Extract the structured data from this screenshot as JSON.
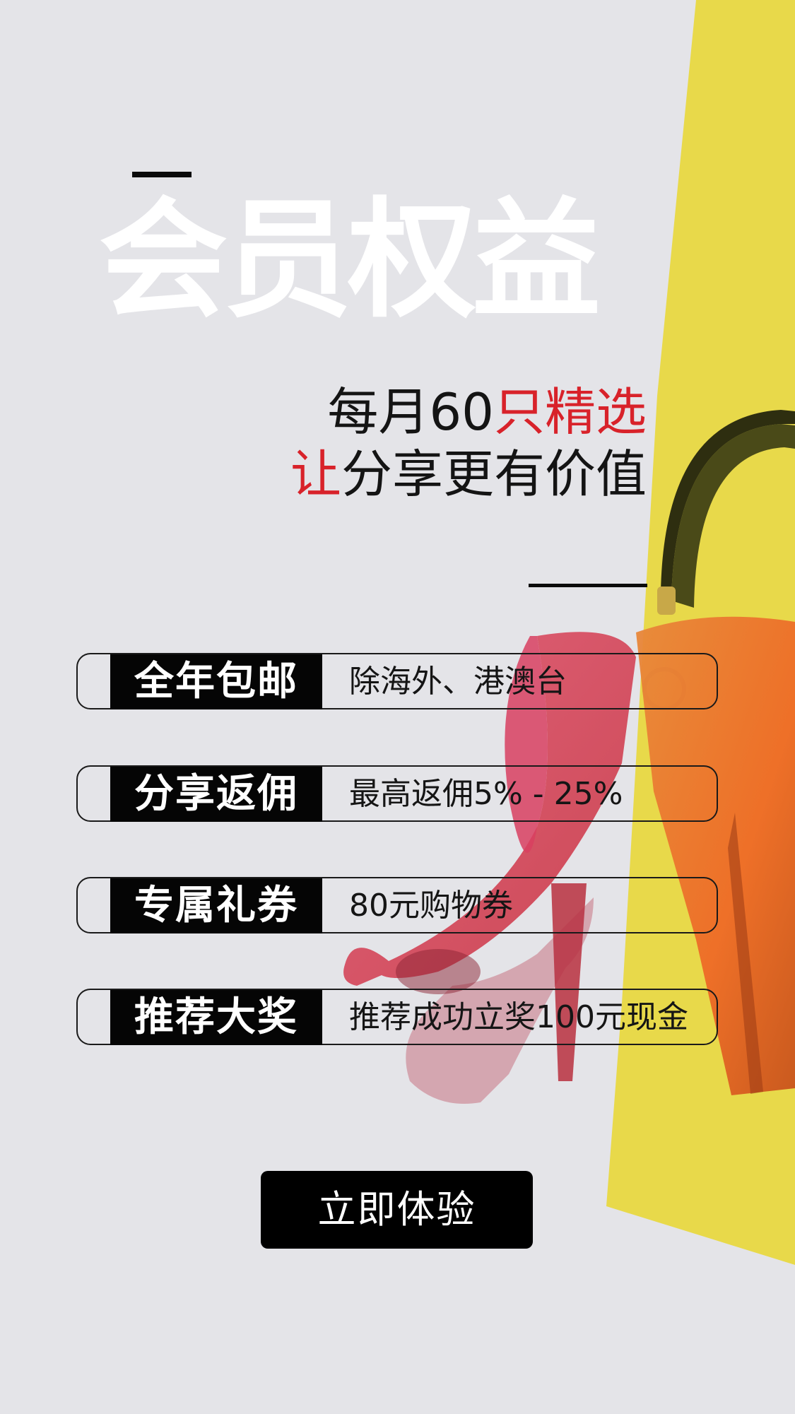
{
  "hero": {
    "title": "会员权益",
    "subtitle_line1_a": "每月60",
    "subtitle_line1_b": "只精选",
    "subtitle_line2_a": "让",
    "subtitle_line2_b": "分享更有价值"
  },
  "benefits": [
    {
      "label": "全年包邮",
      "desc": "除海外、港澳台"
    },
    {
      "label": "分享返佣",
      "desc": "最高返佣5% - 25%"
    },
    {
      "label": "专属礼券",
      "desc": "80元购物券"
    },
    {
      "label": "推荐大奖",
      "desc": "推荐成功立奖100元现金"
    }
  ],
  "cta": {
    "label": "立即体验"
  },
  "colors": {
    "background": "#e4e4e8",
    "accent_yellow": "#e8d94a",
    "accent_red": "#d8222a",
    "label_black": "#050505"
  }
}
